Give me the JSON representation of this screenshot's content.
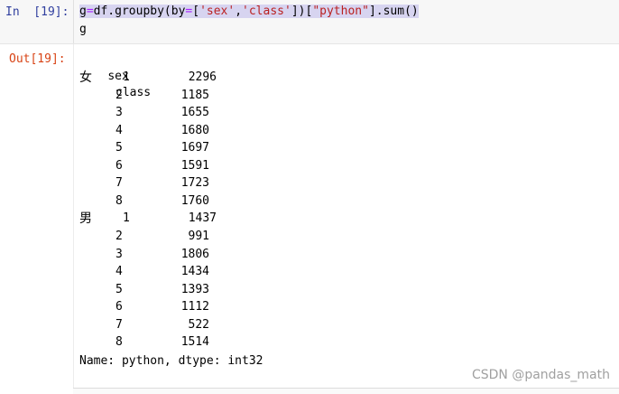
{
  "input_cell": {
    "prompt": "In  [19]:",
    "code_line1_parts": [
      "g",
      "=",
      "df.groupby(by",
      "=",
      "[",
      "'sex'",
      ",",
      "'class'",
      "])[",
      "\"python\"",
      "].sum()"
    ],
    "code_line2": "g"
  },
  "output_cell": {
    "prompt": "Out[19]:",
    "header_sex": "sex",
    "header_class": "class",
    "groups": [
      {
        "sex": "女",
        "rows": [
          {
            "cls": "1",
            "val": "2296"
          },
          {
            "cls": "2",
            "val": "1185"
          },
          {
            "cls": "3",
            "val": "1655"
          },
          {
            "cls": "4",
            "val": "1680"
          },
          {
            "cls": "5",
            "val": "1697"
          },
          {
            "cls": "6",
            "val": "1591"
          },
          {
            "cls": "7",
            "val": "1723"
          },
          {
            "cls": "8",
            "val": "1760"
          }
        ]
      },
      {
        "sex": "男",
        "rows": [
          {
            "cls": "1",
            "val": "1437"
          },
          {
            "cls": "2",
            "val": "991"
          },
          {
            "cls": "3",
            "val": "1806"
          },
          {
            "cls": "4",
            "val": "1434"
          },
          {
            "cls": "5",
            "val": "1393"
          },
          {
            "cls": "6",
            "val": "1112"
          },
          {
            "cls": "7",
            "val": "522"
          },
          {
            "cls": "8",
            "val": "1514"
          }
        ]
      }
    ],
    "footer": "Name: python, dtype: int32"
  },
  "watermark": "CSDN @pandas_math"
}
